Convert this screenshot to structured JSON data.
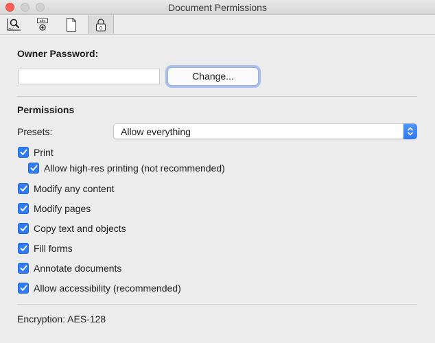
{
  "window": {
    "title": "Document Permissions"
  },
  "toolbar": {
    "tabs": [
      {
        "icon": "magnifier-chart-icon",
        "selected": false
      },
      {
        "icon": "abc-stamp-icon",
        "selected": false
      },
      {
        "icon": "document-icon",
        "selected": false
      },
      {
        "icon": "lock-icon",
        "selected": true
      }
    ]
  },
  "owner_password": {
    "label": "Owner Password:",
    "value": "",
    "change_label": "Change..."
  },
  "permissions": {
    "heading": "Permissions",
    "presets_label": "Presets:",
    "presets_value": "Allow everything",
    "items": [
      {
        "label": "Print",
        "checked": true
      },
      {
        "label": "Allow high-res printing (not recommended)",
        "checked": true
      },
      {
        "label": "Modify any content",
        "checked": true
      },
      {
        "label": "Modify pages",
        "checked": true
      },
      {
        "label": "Copy text and objects",
        "checked": true
      },
      {
        "label": "Fill forms",
        "checked": true
      },
      {
        "label": "Annotate documents",
        "checked": true
      },
      {
        "label": "Allow accessibility (recommended)",
        "checked": true
      }
    ]
  },
  "encryption": {
    "text": "Encryption: AES-128"
  },
  "colors": {
    "accent": "#2f7bf2",
    "close": "#fc5f57",
    "background": "#ececec"
  }
}
